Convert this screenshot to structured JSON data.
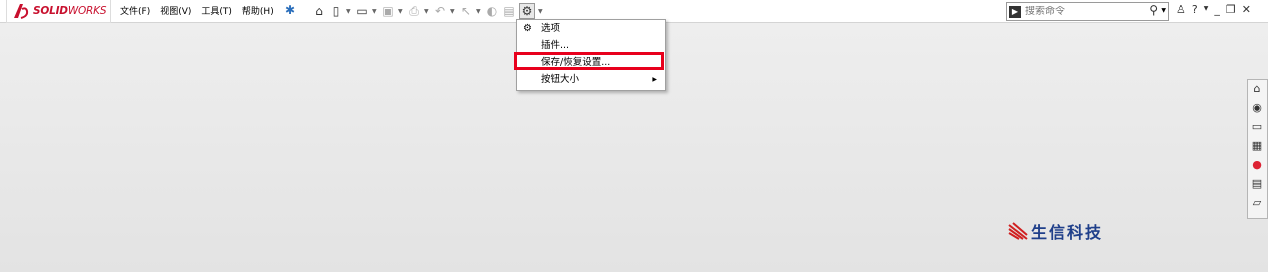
{
  "app": {
    "brand": "SOLIDWORKS",
    "brand_solid": "SOLID",
    "brand_works": "WORKS"
  },
  "menu": [
    "文件(F)",
    "视图(V)",
    "工具(T)",
    "帮助(H)"
  ],
  "toolbar": {
    "icons": [
      "home-icon",
      "new-document-icon",
      "open-folder-icon",
      "save-icon",
      "print-icon",
      "undo-icon",
      "select-icon",
      "rebuild-icon",
      "file-properties-icon",
      "options-gear-icon"
    ]
  },
  "search": {
    "placeholder": "搜索命令"
  },
  "options_menu": {
    "items": [
      {
        "label": "选项",
        "icon": "gear-icon"
      },
      {
        "label": "插件..."
      },
      {
        "label": "保存/恢复设置..."
      },
      {
        "label": "按钮大小",
        "submenu": true
      }
    ]
  },
  "task_pane": {
    "icons": [
      "home-icon",
      "parts-library-icon",
      "file-explorer-icon",
      "view-palette-icon",
      "appearances-icon",
      "custom-properties-icon",
      "forum-icon"
    ]
  },
  "watermark": {
    "text": "生信科技"
  },
  "colors": {
    "highlight": "#e8001c",
    "brand_red": "#c8102e",
    "watermark_blue": "#1f3f8a"
  }
}
